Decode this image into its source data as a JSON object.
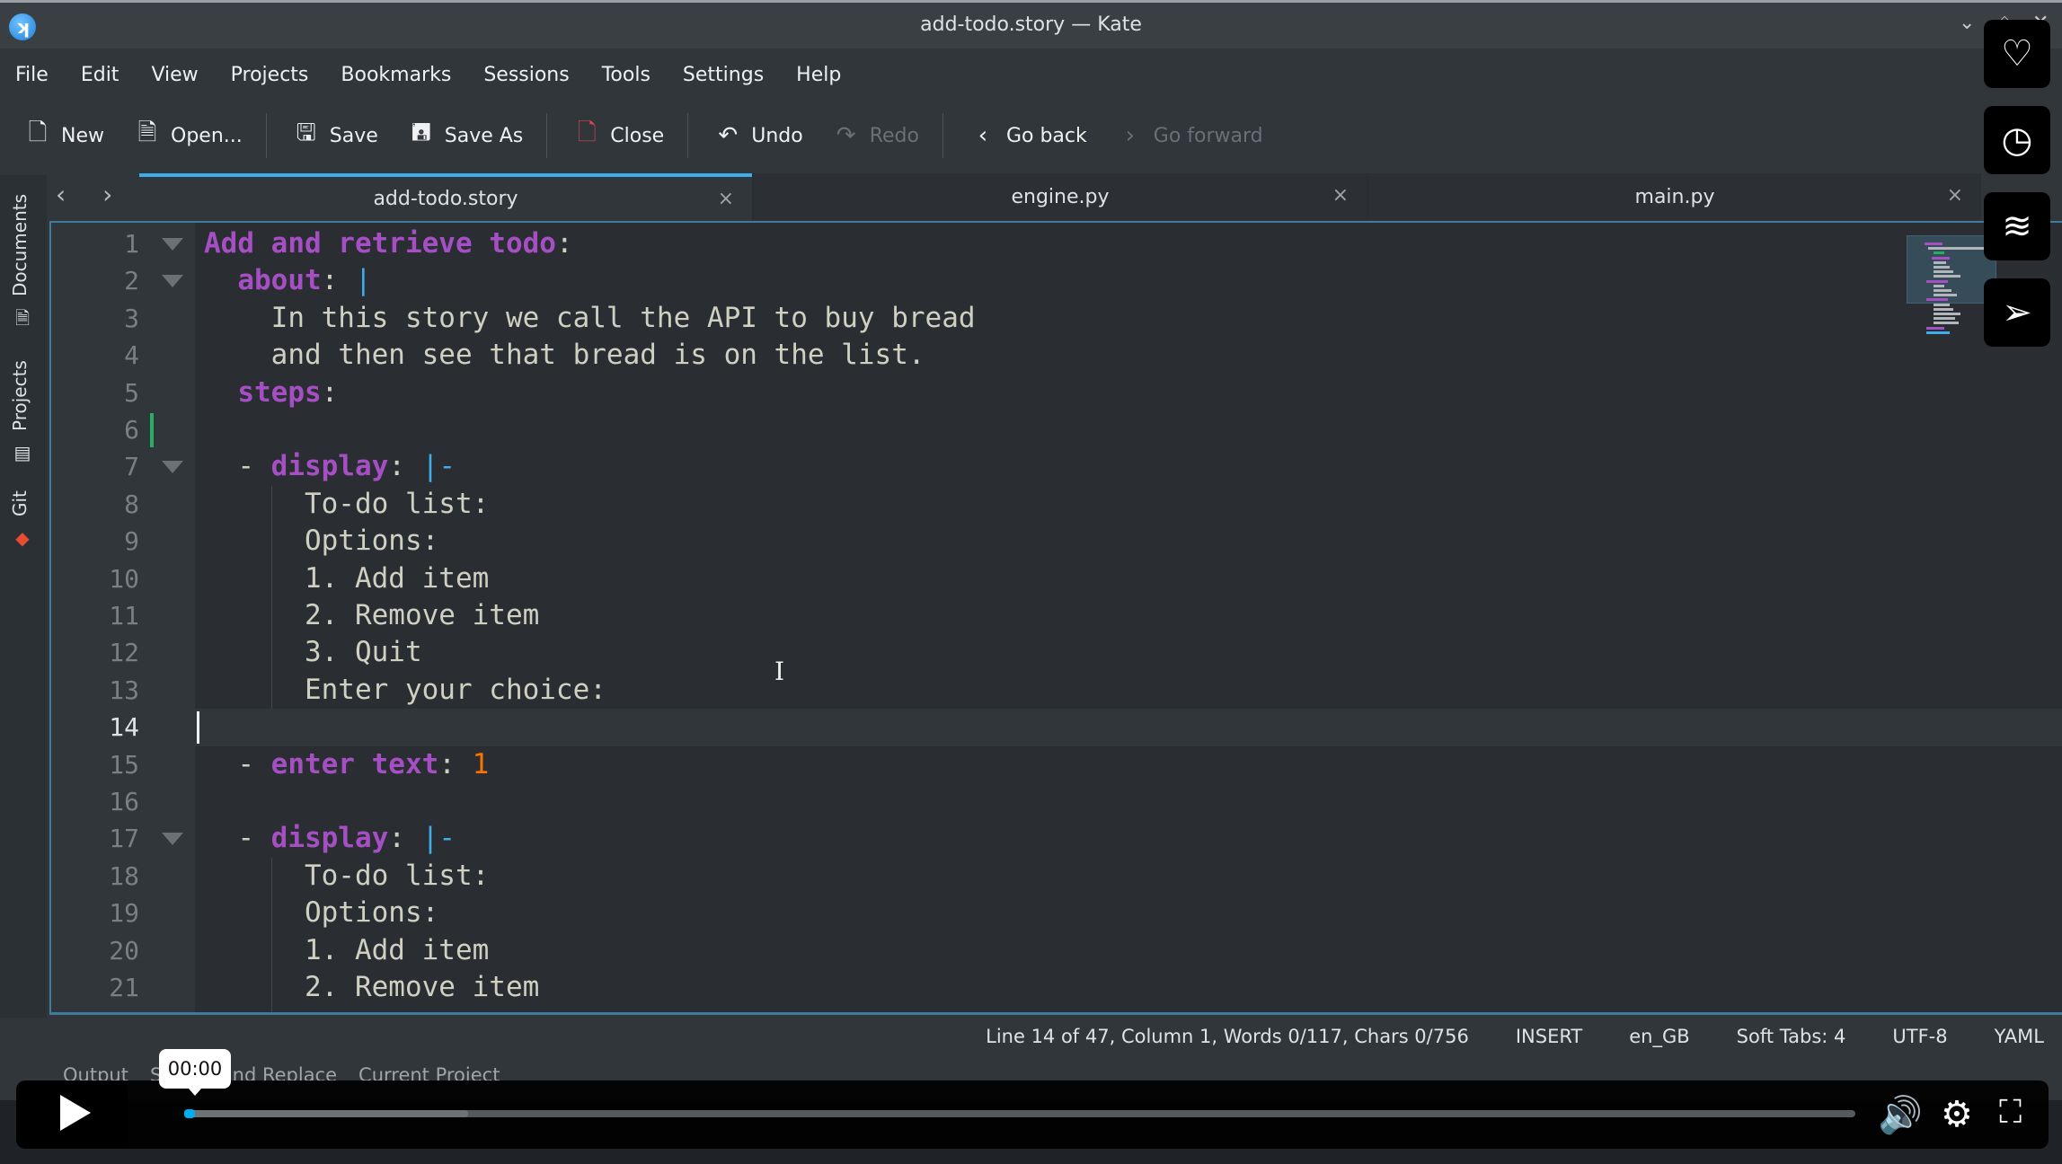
{
  "window": {
    "title": "add-todo.story — Kate",
    "app_icon": "kate-app-icon",
    "controls": [
      "chevron-down-icon",
      "pin-icon",
      "close-icon"
    ]
  },
  "menu": [
    "File",
    "Edit",
    "View",
    "Projects",
    "Bookmarks",
    "Sessions",
    "Tools",
    "Settings",
    "Help"
  ],
  "toolbar": {
    "new": "New",
    "open": "Open...",
    "save": "Save",
    "save_as": "Save As",
    "close": "Close",
    "undo": "Undo",
    "redo": "Redo",
    "go_back": "Go back",
    "go_forward": "Go forward"
  },
  "side_panel": {
    "documents": "Documents",
    "projects": "Projects",
    "git": "Git"
  },
  "tabs": [
    {
      "label": "add-todo.story",
      "active": true
    },
    {
      "label": "engine.py",
      "active": false
    },
    {
      "label": "main.py",
      "active": false
    }
  ],
  "editor": {
    "current_line": 14,
    "lines": [
      {
        "n": "1",
        "text": "Add and retrieve todo:"
      },
      {
        "n": "2",
        "text": "  about: |"
      },
      {
        "n": "3",
        "text": "    In this story we call the API to buy bread"
      },
      {
        "n": "4",
        "text": "    and then see that bread is on the list."
      },
      {
        "n": "5",
        "text": "  steps:"
      },
      {
        "n": "6",
        "text": ""
      },
      {
        "n": "7",
        "text": "  - display: |-"
      },
      {
        "n": "8",
        "text": "      To-do list:"
      },
      {
        "n": "9",
        "text": "      Options:"
      },
      {
        "n": "10",
        "text": "      1. Add item"
      },
      {
        "n": "11",
        "text": "      2. Remove item"
      },
      {
        "n": "12",
        "text": "      3. Quit"
      },
      {
        "n": "13",
        "text": "      Enter your choice:"
      },
      {
        "n": "14",
        "text": ""
      },
      {
        "n": "15",
        "text": "  - enter text: 1"
      },
      {
        "n": "16",
        "text": ""
      },
      {
        "n": "17",
        "text": "  - display: |-"
      },
      {
        "n": "18",
        "text": "      To-do list:"
      },
      {
        "n": "19",
        "text": "      Options:"
      },
      {
        "n": "20",
        "text": "      1. Add item"
      },
      {
        "n": "21",
        "text": "      2. Remove item"
      }
    ],
    "colors": {
      "key": "#a64fc5",
      "block_indicator": "#3daee9",
      "number": "#f67400",
      "text": "#cfcfc2",
      "modified_marker": "#27ae60"
    }
  },
  "statusbar": {
    "position": "Line 14 of 47, Column 1, Words 0/117, Chars 0/756",
    "mode": "INSERT",
    "dictionary": "en_GB",
    "indent": "Soft Tabs: 4",
    "encoding": "UTF-8",
    "syntax": "YAML"
  },
  "bottom_tabs": [
    "Output",
    "Search and Replace",
    "Current Project"
  ],
  "video_player": {
    "time_tooltip": "00:00",
    "progress": 0.005,
    "buffered": 0.17
  },
  "floating_actions": [
    "heart-icon",
    "clock-icon",
    "layers-icon",
    "send-icon"
  ]
}
